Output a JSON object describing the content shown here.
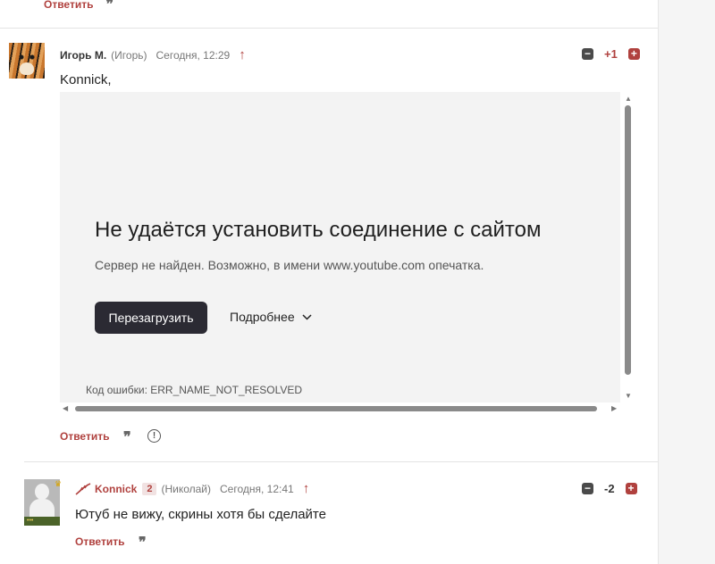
{
  "prev_comment": {
    "reply_label": "Ответить"
  },
  "comment1": {
    "author": "Игорь М.",
    "author_alias": "(Игорь)",
    "time": "Сегодня, 12:29",
    "score": "+1",
    "text": "Konnick,",
    "reply_label": "Ответить",
    "embed": {
      "error_title": "Не удаётся установить соединение с сайтом",
      "error_desc": "Сервер не найден. Возможно, в имени www.youtube.com опечатка.",
      "reload_label": "Перезагрузить",
      "more_label": "Подробнее",
      "error_code": "Код ошибки: ERR_NAME_NOT_RESOLVED"
    }
  },
  "comment2": {
    "author": "Konnick",
    "badge": "2",
    "author_alias": "(Николай)",
    "time": "Сегодня, 12:41",
    "score": "-2",
    "text": "Ютуб не вижу, скрины хотя бы сделайте",
    "reply_label": "Ответить"
  },
  "icons": {
    "quote": "quote-icon",
    "up_arrow": "arrow-up-icon",
    "info": "info-icon",
    "vote_minus": "minus-icon",
    "vote_plus": "plus-icon"
  },
  "colors": {
    "accent": "#b0413e",
    "dark_button": "#2b2a33",
    "error_bg": "#f3f3f3"
  }
}
